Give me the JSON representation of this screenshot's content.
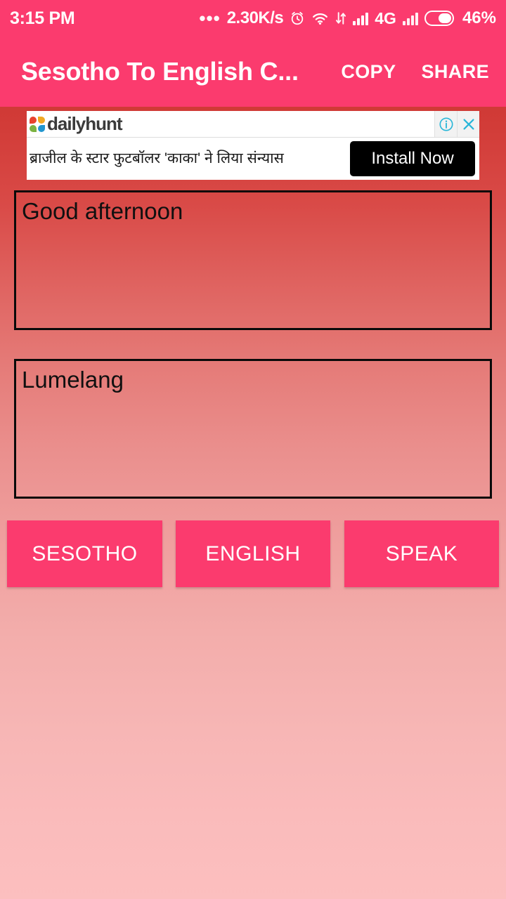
{
  "status_bar": {
    "time": "3:15 PM",
    "dots": "•••",
    "network_speed": "2.30K/s",
    "alarm_icon": "alarm-clock-icon",
    "wifi_icon": "wifi-icon",
    "data_transfer_icon": "data-transfer-icon",
    "signal_icon_1": "signal-bars-icon",
    "network_type": "4G",
    "signal_icon_2": "signal-bars-icon",
    "battery_icon": "battery-icon",
    "battery_percent": "46%",
    "background_color": "#fb3b6e",
    "foreground_color": "#ffffff"
  },
  "app_bar": {
    "title": "Sesotho To English C...",
    "copy_label": "COPY",
    "share_label": "SHARE",
    "background_color": "#fb3b6e"
  },
  "advertisement": {
    "brand": "dailyhunt",
    "logo_icon": "dailyhunt-petals-icon",
    "info_icon": "info-circle-icon",
    "close_icon": "close-x-icon",
    "headline": "ब्राजील के स्टार फुटबॉलर 'काका' ने लिया संन्यास",
    "cta_label": "Install Now",
    "cta_background": "#000000",
    "icon_color": "#29b6d8"
  },
  "translator": {
    "source_text": "Good afternoon",
    "source_placeholder": "",
    "target_text": "Lumelang",
    "target_placeholder": "",
    "buttons": [
      {
        "label": "SESOTHO",
        "name": "sesotho-button"
      },
      {
        "label": "ENGLISH",
        "name": "english-button"
      },
      {
        "label": "SPEAK",
        "name": "speak-button"
      }
    ],
    "button_color": "#fb3b6e"
  },
  "theme": {
    "accent": "#fb3b6e",
    "background_top": "#c5302c",
    "background_bottom": "#fcbfbf"
  }
}
